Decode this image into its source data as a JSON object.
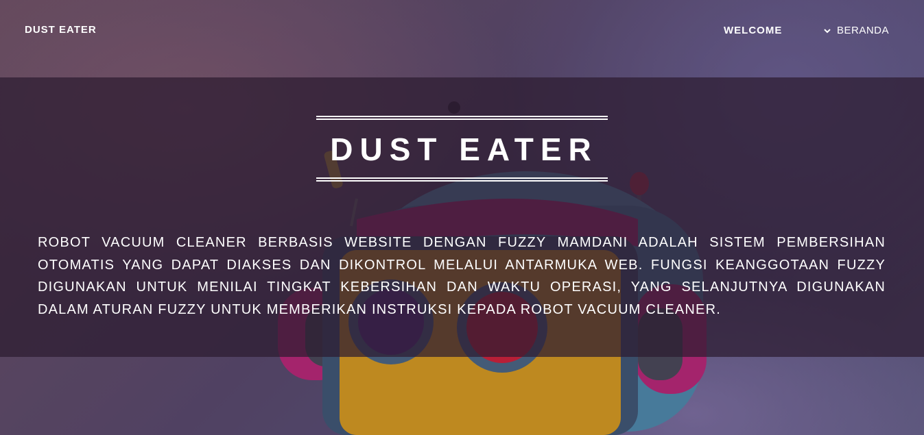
{
  "header": {
    "brand": "DUST EATER",
    "nav": {
      "welcome_label": "WELCOME",
      "dropdown_label": "BERANDA"
    }
  },
  "hero": {
    "title": "DUST EATER",
    "description": "ROBOT VACUUM CLEANER BERBASIS WEBSITE DENGAN FUZZY MAMDANI ADALAH SISTEM PEMBERSIHAN OTOMATIS YANG DAPAT DIAKSES DAN DIKONTROL MELALUI ANTARMUKA WEB. FUNGSI KEANGGOTAAN FUZZY DIGUNAKAN UNTUK MENILAI TINGKAT KEBERSIHAN DAN WAKTU OPERASI, YANG SELANJUTNYA DIGUNAKAN DALAM ATURAN FUZZY UNTUK MEMBERIKAN INSTRUKSI KEPADA ROBOT VACUUM CLEANER.",
    "background_icon": "robot-illustration"
  },
  "colors": {
    "text": "#ffffff",
    "band_overlay": "#2d1c30",
    "robot_body": "#5fa7c8",
    "robot_face": "#e0a21e",
    "robot_magenta": "#c0267a",
    "robot_eye_left": "#5a2d8a",
    "robot_eye_right": "#d8203a"
  },
  "icons": {
    "dropdown": "chevron-down-icon"
  }
}
